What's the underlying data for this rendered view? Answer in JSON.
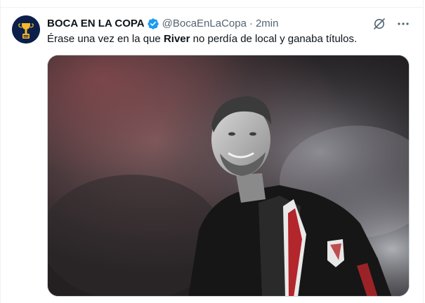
{
  "tweet": {
    "author": {
      "display_name": "BOCA EN LA COPA",
      "handle": "@BocaEnLaCopa",
      "verified": true,
      "avatar_icon": "trophy-icon",
      "avatar_bg": "#0b1f4a",
      "avatar_accent": "#f5b82e"
    },
    "separator": "·",
    "time": "2min",
    "text_before": "Érase una vez en la que ",
    "text_bold": "River",
    "text_after": " no perdía de local y ganaba títulos.",
    "media": {
      "kind": "photo",
      "tone": "black-and-white with red smoke"
    }
  },
  "icons": {
    "verified": "verified-badge-icon",
    "grok": "grok-icon",
    "more": "more-options-icon"
  },
  "colors": {
    "text_primary": "#0f1419",
    "text_secondary": "#536471",
    "verified_blue": "#1d9bf0",
    "border": "#cfd9de"
  }
}
